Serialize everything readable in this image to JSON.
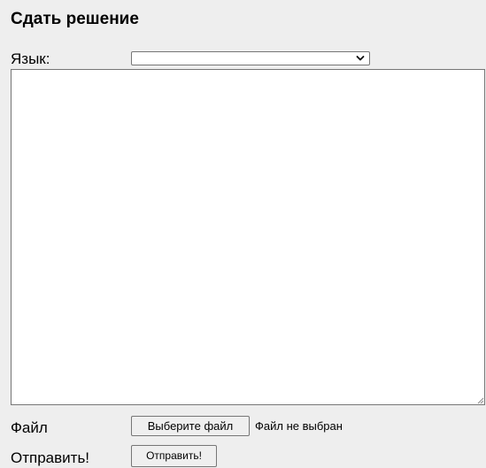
{
  "form": {
    "title": "Сдать решение",
    "language_label": "Язык:",
    "language_selected": "",
    "code_value": "",
    "file_label": "Файл",
    "file_button_label": "Выберите файл",
    "file_status": "Файл не выбран",
    "submit_label": "Отправить!",
    "submit_button_label": "Отправить!"
  },
  "icons": {
    "select_arrow": "chevron-down-icon",
    "textarea_resize": "resize-grip-icon"
  },
  "colors": {
    "panel_background": "#eeeeee",
    "field_background": "#ffffff",
    "border": "#767676",
    "button_background": "#efefef"
  }
}
